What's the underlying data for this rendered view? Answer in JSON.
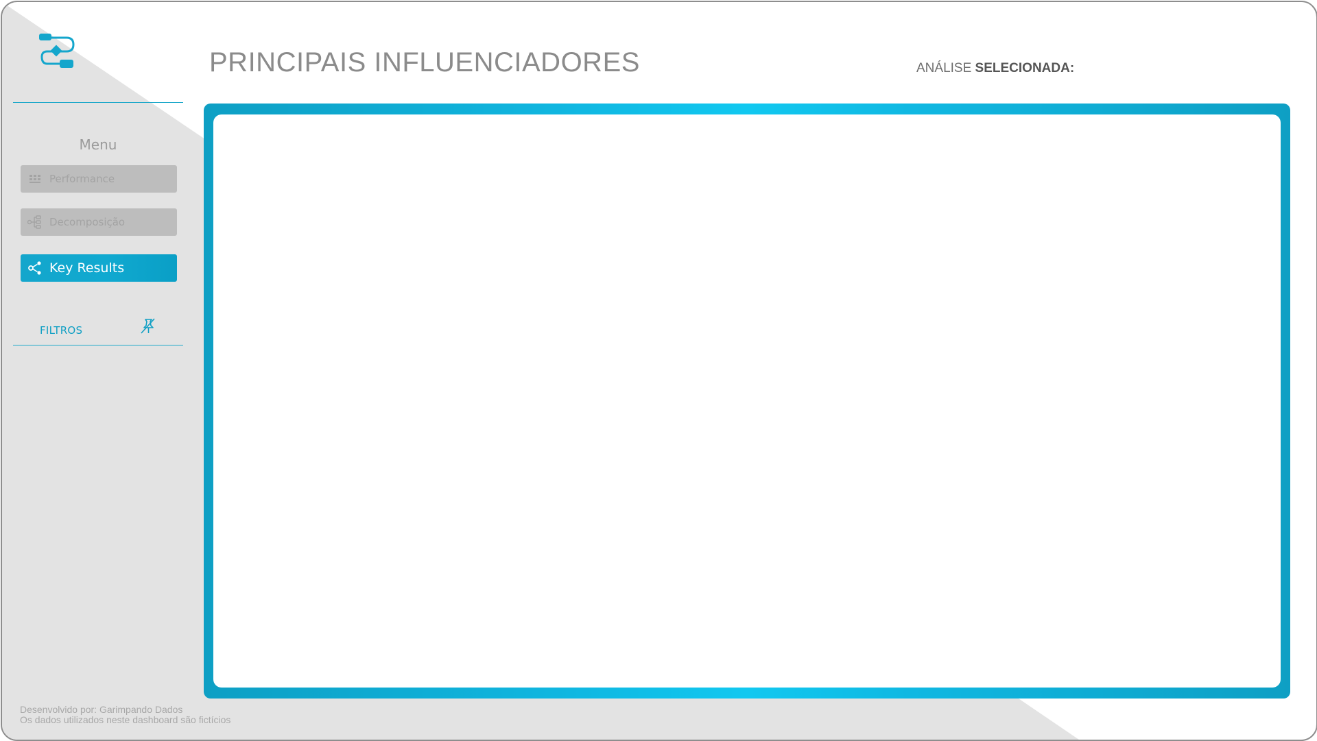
{
  "header": {
    "title": "PRINCIPAIS INFLUENCIADORES",
    "analysis_prefix": "ANÁLISE",
    "analysis_bold": "SELECIONADA:"
  },
  "sidebar": {
    "menu_title": "Menu",
    "items": [
      {
        "label": "Performance",
        "icon": "grid-icon",
        "state": "inactive"
      },
      {
        "label": "Decomposição",
        "icon": "tree-icon",
        "state": "inactive"
      },
      {
        "label": "Key Results",
        "icon": "share-icon",
        "state": "active"
      }
    ],
    "filters_label": "FILTROS",
    "filters_icon": "pin-off-icon"
  },
  "footer": {
    "line1": "Desenvolvido por: Garimpando Dados",
    "line2": "Os dados utilizados neste dashboard são fictícios"
  },
  "colors": {
    "accent": "#10a9d0",
    "sidebar_bg": "#e3e3e3",
    "border": "#8e8e8e"
  }
}
